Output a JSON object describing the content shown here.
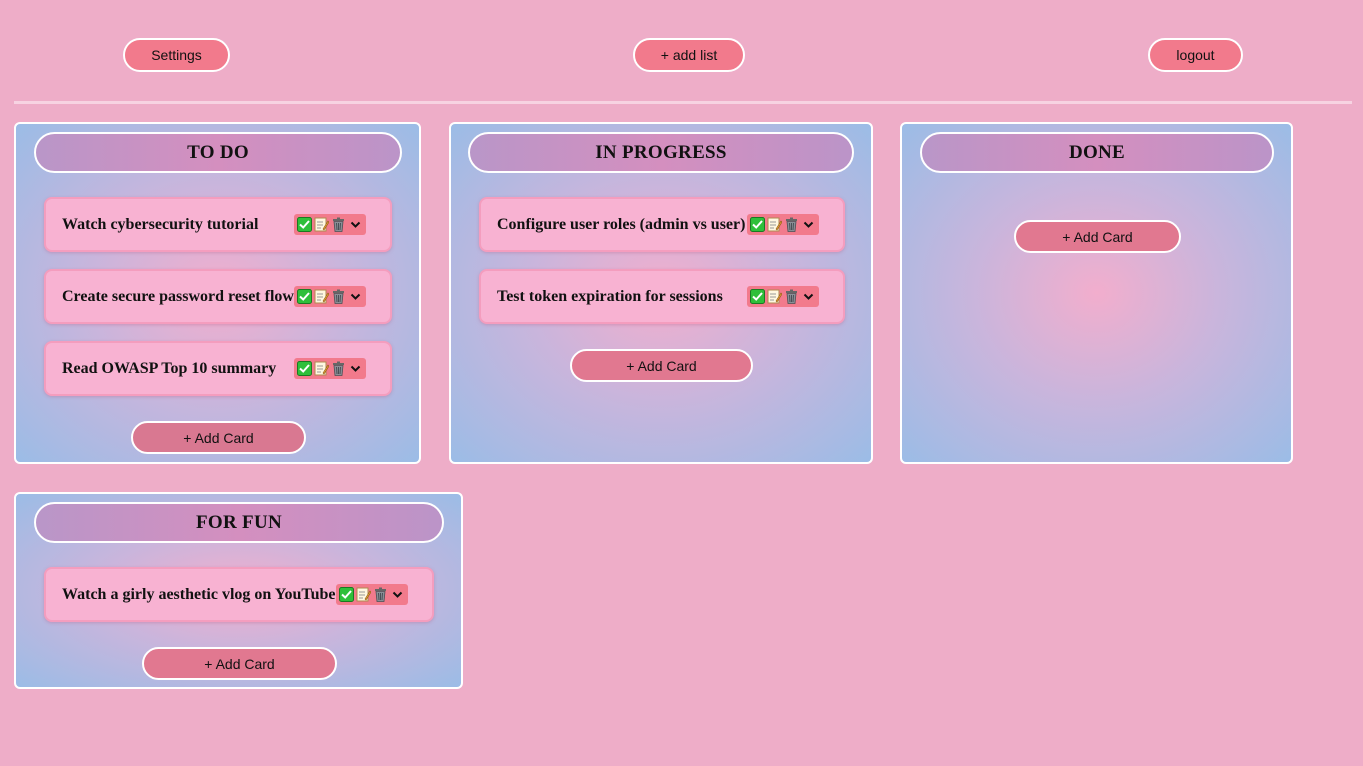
{
  "header": {
    "settings_label": "Settings",
    "add_list_label": "+ add list",
    "logout_label": "logout"
  },
  "lists": [
    {
      "title": "TO DO",
      "cards": [
        {
          "text": "Watch cybersecurity tutorial"
        },
        {
          "text": "Create secure password reset flow"
        },
        {
          "text": "Read OWASP Top 10 summary"
        }
      ],
      "add_card_label": "+ Add Card"
    },
    {
      "title": "IN PROGRESS",
      "cards": [
        {
          "text": "Configure user roles (admin vs user)"
        },
        {
          "text": "Test token expiration for sessions"
        }
      ],
      "add_card_label": "+ Add Card"
    },
    {
      "title": "DONE",
      "cards": [],
      "add_card_label": "+ Add Card"
    },
    {
      "title": "FOR FUN",
      "cards": [
        {
          "text": "Watch a girly aesthetic vlog on YouTube"
        }
      ],
      "add_card_label": "+ Add Card"
    }
  ],
  "card_action_icons": [
    "check-icon",
    "edit-note-icon",
    "trash-icon",
    "chevron-down-icon"
  ],
  "colors": {
    "background": "#eeadc8",
    "button": "#f27a8c",
    "card": "#f8b2d2",
    "add_card_button": "#e17890"
  }
}
